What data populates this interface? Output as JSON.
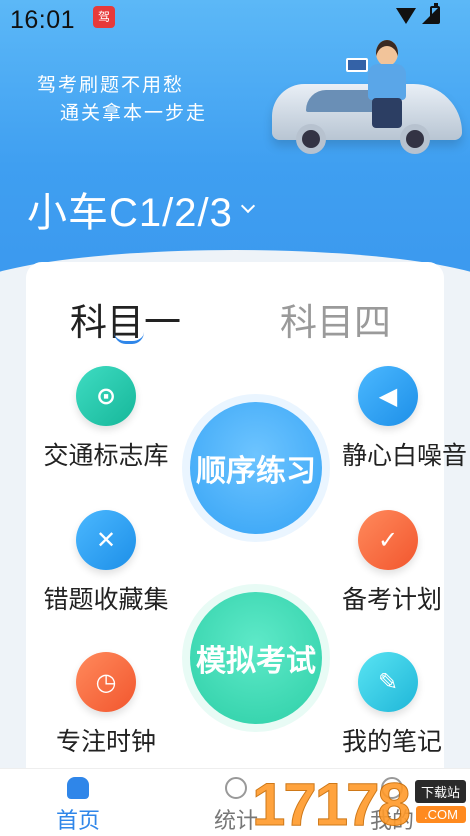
{
  "status": {
    "time": "16:01",
    "app_badge": "驾"
  },
  "hero": {
    "slogan_line1": "驾考刷题不用愁",
    "slogan_line2": "通关拿本一步走",
    "car_type": "小车C1/2/3"
  },
  "subjects": {
    "active": "科目一",
    "inactive": "科目四"
  },
  "tools_left": [
    {
      "label": "交通标志库",
      "icon": "traffic-sign-icon"
    },
    {
      "label": "错题收藏集",
      "icon": "notebook-icon"
    },
    {
      "label": "专注时钟",
      "icon": "clock-icon"
    }
  ],
  "tools_right": [
    {
      "label": "静心白噪音",
      "icon": "speaker-icon"
    },
    {
      "label": "备考计划",
      "icon": "clipboard-icon"
    },
    {
      "label": "我的笔记",
      "icon": "note-icon"
    }
  ],
  "main_actions": {
    "sequential": "顺序练习",
    "mock": "模拟考试"
  },
  "tabbar": {
    "home": "首页",
    "stats": "统计",
    "mine": "我的"
  },
  "watermark": {
    "number": "17178",
    "badge": "下载站",
    "domain": ".COM"
  },
  "colors": {
    "primary": "#2f86e9",
    "hero": "#3f9ff1"
  }
}
